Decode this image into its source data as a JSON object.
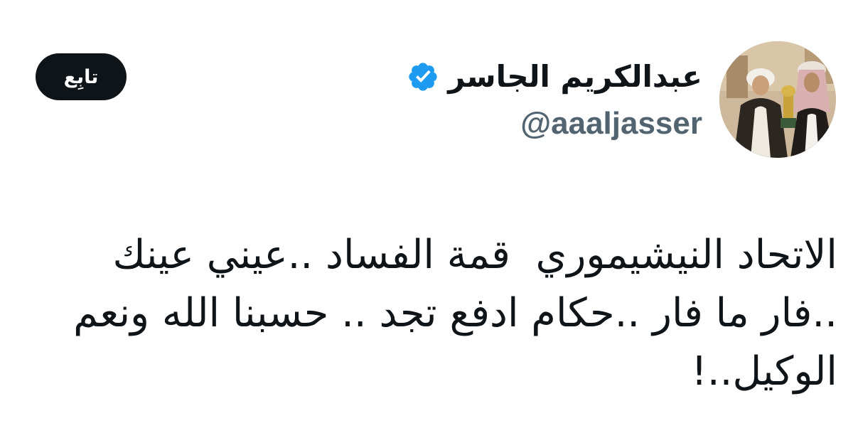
{
  "author": {
    "display_name": "عبدالكريم الجاسر",
    "handle": "@aaaljasser",
    "verified": true,
    "avatar": "profile-photo"
  },
  "follow_button": {
    "label": "تابِع"
  },
  "tweet": {
    "text": "الاتحاد النيشيموري  قمة الفساد ..عيني عينك ..فار ما فار ..حكام ادفع تجد .. حسبنا الله ونعم الوكيل..!"
  },
  "colors": {
    "text": "#0f1419",
    "secondary_text": "#536471",
    "verified_badge": "#1d9bf0",
    "button_bg": "#0f1419",
    "button_text": "#ffffff"
  }
}
